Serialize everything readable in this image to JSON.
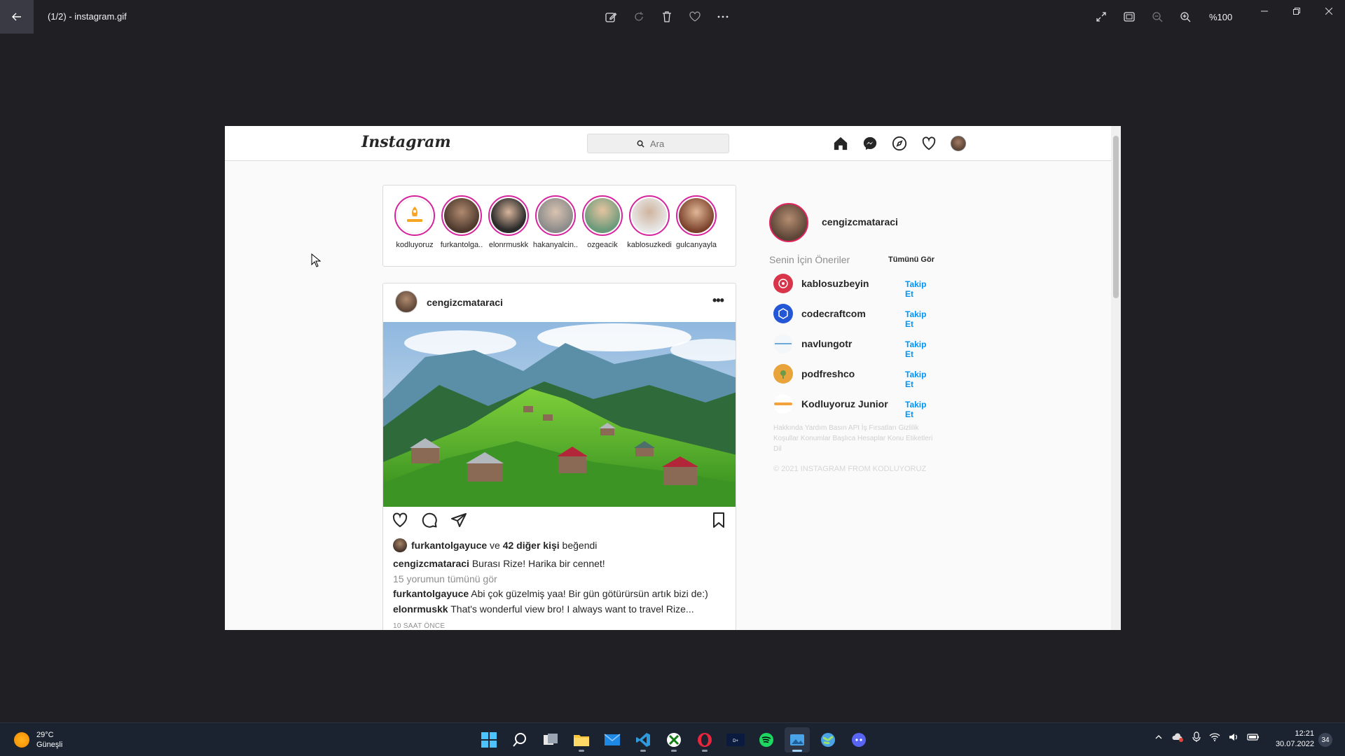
{
  "viewer": {
    "title": "(1/2) - instagram.gif",
    "zoom": "%100",
    "icons_center": [
      "edit-icon",
      "rotate-icon",
      "delete-icon",
      "favorite-icon",
      "more-icon"
    ],
    "icons_right": [
      "fullscreen-icon",
      "fit-icon",
      "zoom-out-icon",
      "zoom-in-icon"
    ]
  },
  "instagram": {
    "logo": "Instagram",
    "search_placeholder": "Ara",
    "stories": [
      {
        "name": "kodluyoruz",
        "color": "#f6a623"
      },
      {
        "name": "furkantolga..",
        "color": "#6b4f3c"
      },
      {
        "name": "elonrmuskk",
        "color": "#2b2b2b"
      },
      {
        "name": "hakanyalcin..",
        "color": "#9a9a9a"
      },
      {
        "name": "ozgeacik",
        "color": "#c79a6b"
      },
      {
        "name": "kablosuzkedi",
        "color": "#3a3a3a"
      },
      {
        "name": "gulcanyayla",
        "color": "#b56a45"
      }
    ],
    "post": {
      "user": "cengizcmataraci",
      "likes_user": "furkantolgayuce",
      "likes_mid": "ve",
      "likes_count": "42 diğer kişi",
      "likes_suffix": "beğendi",
      "caption_user": "cengizcmataraci",
      "caption": "Burası Rize! Harika bir cennet!",
      "view_comments": "15 yorumun tümünü gör",
      "comments": [
        {
          "user": "furkantolgayuce",
          "text": "Abi çok güzelmiş yaa! Bir gün götürürsün artık bizi de:)"
        },
        {
          "user": "elonrmuskk",
          "text": "That's wonderful view bro! I always want to travel Rize..."
        }
      ],
      "time": "10 SAAT ÖNCE"
    },
    "sidebar": {
      "user": "cengizcmataraci",
      "suggestions_title": "Senin İçin Öneriler",
      "see_all": "Tümünü Gör",
      "follow_label": "Takip Et",
      "suggestions": [
        {
          "name": "kablosuzbeyin",
          "color": "#d8344a"
        },
        {
          "name": "codecraftcom",
          "color": "#2457d6"
        },
        {
          "name": "navlungotr",
          "color": "#e8f0f6"
        },
        {
          "name": "podfreshco",
          "color": "#e8a33a"
        },
        {
          "name": "Kodluyoruz Junior",
          "color": "#f4a23c"
        }
      ],
      "footer": "Hakkında Yardım Basın API İş Fırsatları Gizlilik Koşullar Konumlar Başlıca Hesaplar Konu Etiketleri Dil",
      "copyright": "© 2021 INSTAGRAM FROM KODLUYORUZ"
    }
  },
  "taskbar": {
    "temperature": "29°C",
    "condition": "Güneşli",
    "time": "12:21",
    "date": "30.07.2022",
    "notifications": "34",
    "apps": [
      "start-icon",
      "search-icon",
      "task-view-icon",
      "file-explorer-icon",
      "mail-icon",
      "vscode-icon",
      "xbox-icon",
      "opera-icon",
      "disney-plus-icon",
      "spotify-icon",
      "photos-icon",
      "maps-icon",
      "discord-icon"
    ]
  }
}
